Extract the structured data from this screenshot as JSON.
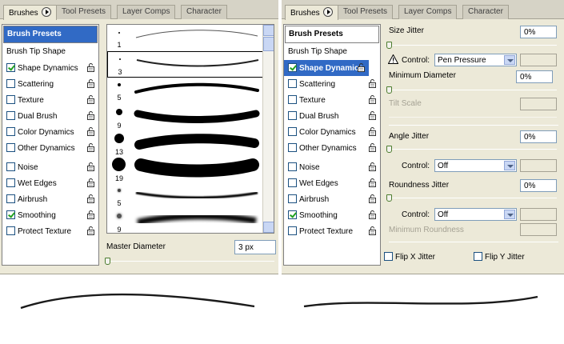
{
  "tabs": {
    "brushes": "Brushes",
    "tool_presets": "Tool Presets",
    "layer_comps": "Layer Comps",
    "character": "Character"
  },
  "left_options": {
    "presets": "Brush Presets",
    "tip_shape": "Brush Tip Shape",
    "items": [
      {
        "label": "Shape Dynamics",
        "checked": true
      },
      {
        "label": "Scattering",
        "checked": false
      },
      {
        "label": "Texture",
        "checked": false
      },
      {
        "label": "Dual Brush",
        "checked": false
      },
      {
        "label": "Color Dynamics",
        "checked": false
      },
      {
        "label": "Other Dynamics",
        "checked": false
      },
      {
        "label": "Noise",
        "checked": false
      },
      {
        "label": "Wet Edges",
        "checked": false
      },
      {
        "label": "Airbrush",
        "checked": false
      },
      {
        "label": "Smoothing",
        "checked": true
      },
      {
        "label": "Protect Texture",
        "checked": false
      }
    ]
  },
  "brush_tips": [
    {
      "size": "1"
    },
    {
      "size": "3"
    },
    {
      "size": "5"
    },
    {
      "size": "9"
    },
    {
      "size": "13"
    },
    {
      "size": "19"
    },
    {
      "size": "5"
    },
    {
      "size": "9"
    }
  ],
  "master_diameter": {
    "label": "Master Diameter",
    "value": "3 px",
    "level": 0.0
  },
  "right_options": {
    "presets": "Brush Presets",
    "tip_shape": "Brush Tip Shape",
    "items": [
      {
        "label": "Shape Dynamics",
        "checked": true
      },
      {
        "label": "Scattering",
        "checked": false
      },
      {
        "label": "Texture",
        "checked": false
      },
      {
        "label": "Dual Brush",
        "checked": false
      },
      {
        "label": "Color Dynamics",
        "checked": false
      },
      {
        "label": "Other Dynamics",
        "checked": false
      },
      {
        "label": "Noise",
        "checked": false
      },
      {
        "label": "Wet Edges",
        "checked": false
      },
      {
        "label": "Airbrush",
        "checked": false
      },
      {
        "label": "Smoothing",
        "checked": true
      },
      {
        "label": "Protect Texture",
        "checked": false
      }
    ]
  },
  "shape_dynamics": {
    "size_jitter": {
      "label": "Size Jitter",
      "value": "0%"
    },
    "size_control": {
      "label": "Control:",
      "value": "Pen Pressure"
    },
    "min_diameter": {
      "label": "Minimum Diameter",
      "value": "0%"
    },
    "tilt_scale": {
      "label": "Tilt Scale"
    },
    "angle_jitter": {
      "label": "Angle Jitter",
      "value": "0%"
    },
    "angle_control": {
      "label": "Control:",
      "value": "Off"
    },
    "roundness_jitter": {
      "label": "Roundness Jitter",
      "value": "0%"
    },
    "roundness_control": {
      "label": "Control:",
      "value": "Off"
    },
    "min_roundness": {
      "label": "Minimum Roundness"
    },
    "flip_x": {
      "label": "Flip X Jitter",
      "checked": false
    },
    "flip_y": {
      "label": "Flip Y Jitter",
      "checked": false
    }
  },
  "colors": {
    "selected": "#316ac5",
    "panel": "#ece9d8",
    "check": "#21a121"
  }
}
